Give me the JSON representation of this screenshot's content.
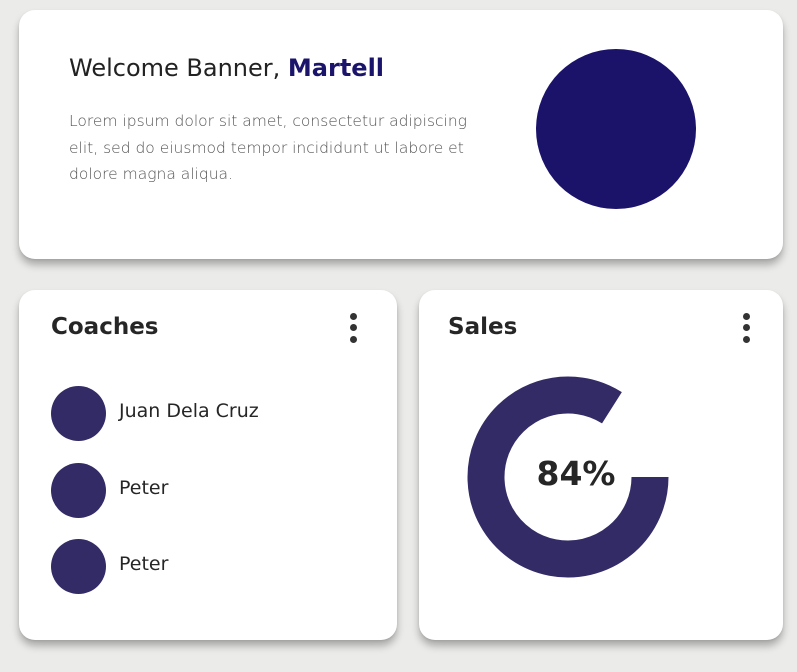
{
  "banner": {
    "title_prefix": "Welcome Banner, ",
    "user_name": "Martell",
    "body": "Lorem ipsum dolor sit amet, consectetur adipiscing elit, sed do eiusmod tempor incididunt ut labore et dolore magna aliqua.",
    "circle_color": "#1b136a"
  },
  "coaches": {
    "title": "Coaches",
    "avatar_color": "#332b65",
    "items": [
      {
        "name": "Juan Dela Cruz"
      },
      {
        "name": "Peter"
      },
      {
        "name": "Peter"
      }
    ]
  },
  "sales": {
    "title": "Sales",
    "percent_label": "84%",
    "percent": 84,
    "ring_color": "#332b65"
  }
}
